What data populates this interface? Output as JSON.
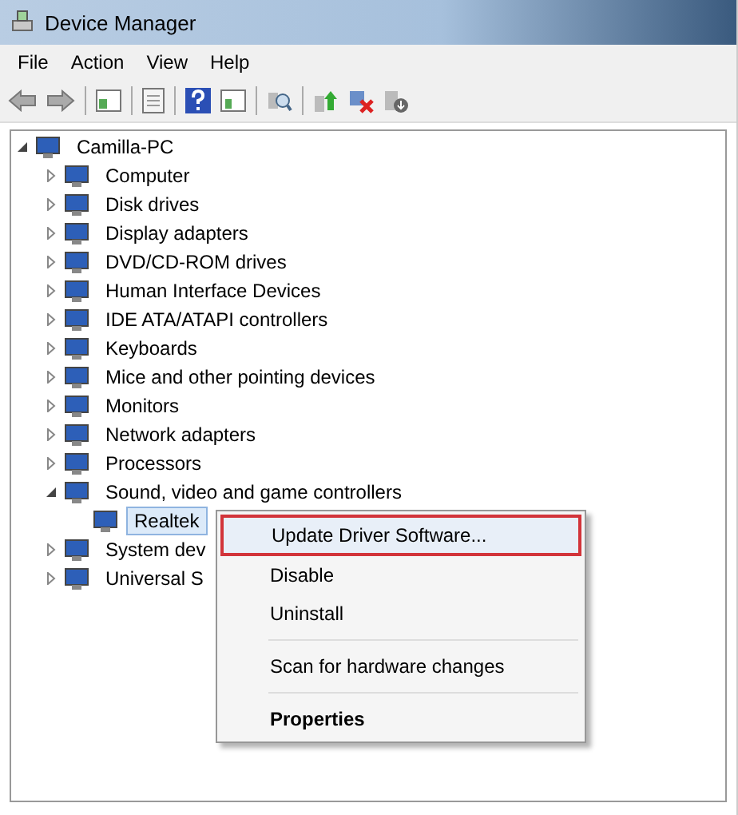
{
  "window": {
    "title": "Device Manager"
  },
  "menu_bar": [
    "File",
    "Action",
    "View",
    "Help"
  ],
  "tree": [
    {
      "label": "Camilla-PC",
      "expanded": true,
      "selected": false,
      "children": [
        {
          "label": "Computer",
          "expanded": false,
          "selected": false
        },
        {
          "label": "Disk drives",
          "expanded": false,
          "selected": false
        },
        {
          "label": "Display adapters",
          "expanded": false,
          "selected": false
        },
        {
          "label": "DVD/CD-ROM drives",
          "expanded": false,
          "selected": false
        },
        {
          "label": "Human Interface Devices",
          "expanded": false,
          "selected": false
        },
        {
          "label": "IDE ATA/ATAPI controllers",
          "expanded": false,
          "selected": false
        },
        {
          "label": "Keyboards",
          "expanded": false,
          "selected": false
        },
        {
          "label": "Mice and other pointing devices",
          "expanded": false,
          "selected": false
        },
        {
          "label": "Monitors",
          "expanded": false,
          "selected": false
        },
        {
          "label": "Network adapters",
          "expanded": false,
          "selected": false
        },
        {
          "label": "Processors",
          "expanded": false,
          "selected": false
        },
        {
          "label": "Sound, video and game controllers",
          "expanded": true,
          "selected": false,
          "children": [
            {
              "label": "Realtek",
              "selected": true
            }
          ]
        },
        {
          "label": "System dev",
          "expanded": false,
          "selected": false
        },
        {
          "label": "Universal S",
          "expanded": false,
          "selected": false
        }
      ]
    }
  ],
  "context_menu": [
    {
      "kind": "item",
      "label": "Update Driver Software...",
      "selected": true,
      "default": false
    },
    {
      "kind": "item",
      "label": "Disable",
      "selected": false,
      "default": false
    },
    {
      "kind": "item",
      "label": "Uninstall",
      "selected": false,
      "default": false
    },
    {
      "kind": "separator"
    },
    {
      "kind": "item",
      "label": "Scan for hardware changes",
      "selected": false,
      "default": false
    },
    {
      "kind": "separator"
    },
    {
      "kind": "item",
      "label": "Properties",
      "selected": false,
      "default": true
    }
  ]
}
